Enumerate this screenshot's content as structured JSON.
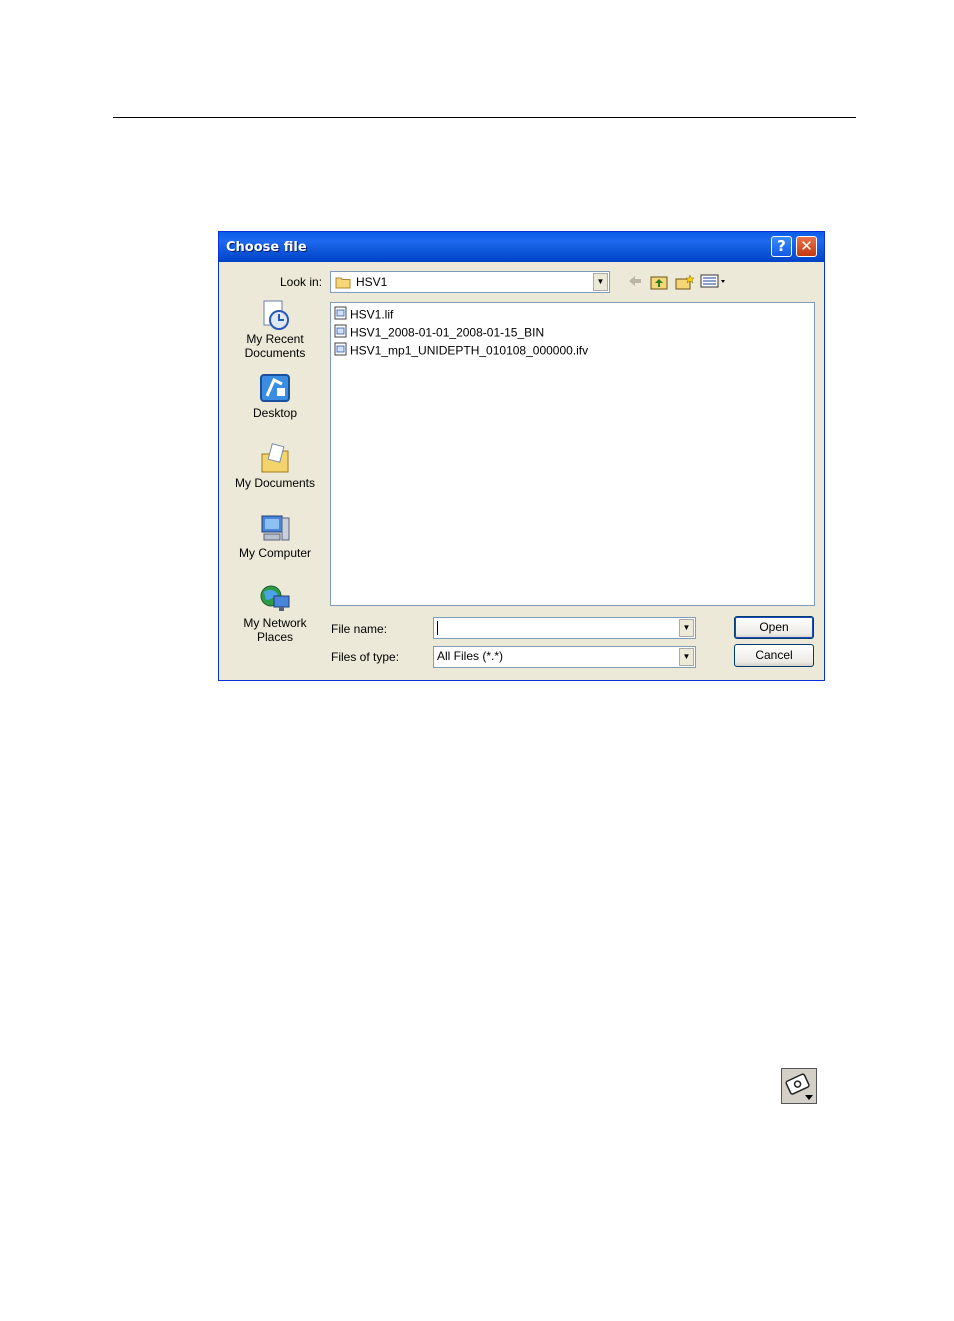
{
  "dialog": {
    "title": "Choose file",
    "help_glyph": "?",
    "close_glyph": "✕",
    "look_in_label": "Look in:",
    "look_in_value": "HSV1",
    "places": [
      {
        "label_lines": [
          "My Recent",
          "Documents"
        ],
        "icon": "recent-documents-icon"
      },
      {
        "label_lines": [
          "Desktop"
        ],
        "icon": "desktop-icon"
      },
      {
        "label_lines": [
          "My Documents"
        ],
        "icon": "my-documents-icon"
      },
      {
        "label_lines": [
          "My Computer"
        ],
        "icon": "my-computer-icon"
      },
      {
        "label_lines": [
          "My Network",
          "Places"
        ],
        "icon": "network-places-icon"
      }
    ],
    "files": [
      "HSV1.lif",
      "HSV1_2008-01-01_2008-01-15_BIN",
      "HSV1_mp1_UNIDEPTH_010108_000000.ifv"
    ],
    "file_name_label": "File name:",
    "file_name_value": "",
    "files_of_type_label": "Files of type:",
    "files_of_type_value": "All Files (*.*)",
    "open_label": "Open",
    "cancel_label": "Cancel"
  },
  "icons": {
    "back": "back-arrow-icon",
    "up": "up-folder-icon",
    "new_folder": "new-folder-icon",
    "views": "views-menu-icon",
    "folder": "folder-icon",
    "file": "file-icon",
    "external": "cd-drive-icon"
  },
  "colors": {
    "titlebar": "#0a5ce9",
    "dialog_bg": "#ece9d8",
    "close": "#c4380e"
  }
}
